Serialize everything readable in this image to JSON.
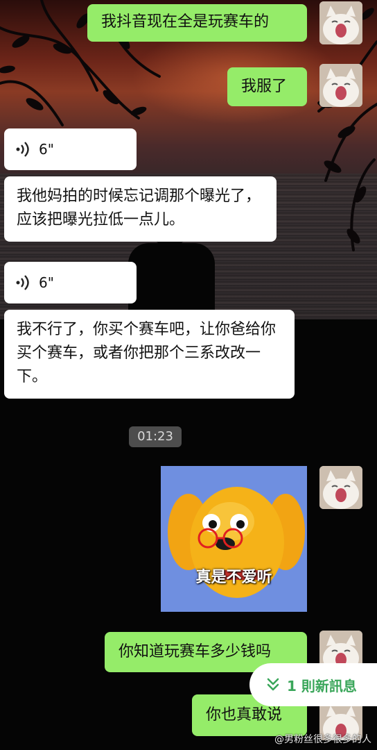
{
  "messages": [
    {
      "text": "我抖音现在全是玩赛车的"
    },
    {
      "text": "我服了"
    },
    {
      "duration": "6\""
    },
    {
      "text": "我他妈拍的时候忘记调那个曝光了，应该把曝光拉低一点儿。"
    },
    {
      "duration": "6\""
    },
    {
      "text": "我不行了，你买个赛车吧，让你爸给你买个赛车，或者你把那个三系改改一下。"
    },
    {
      "timestamp": "01:23"
    },
    {
      "sticker_caption": "真是不爱听"
    },
    {
      "text": "你知道玩赛车多少钱吗"
    },
    {
      "text": "你也真敢说"
    }
  ],
  "new_messages_pill": {
    "label": "1 則新訊息",
    "icon": "double-chevron-down-icon"
  },
  "watermark": "@男粉丝很多很多的人",
  "colors": {
    "sent_bubble": "#95ec69",
    "received_bubble": "#ffffff",
    "accent": "#3aa65a"
  }
}
